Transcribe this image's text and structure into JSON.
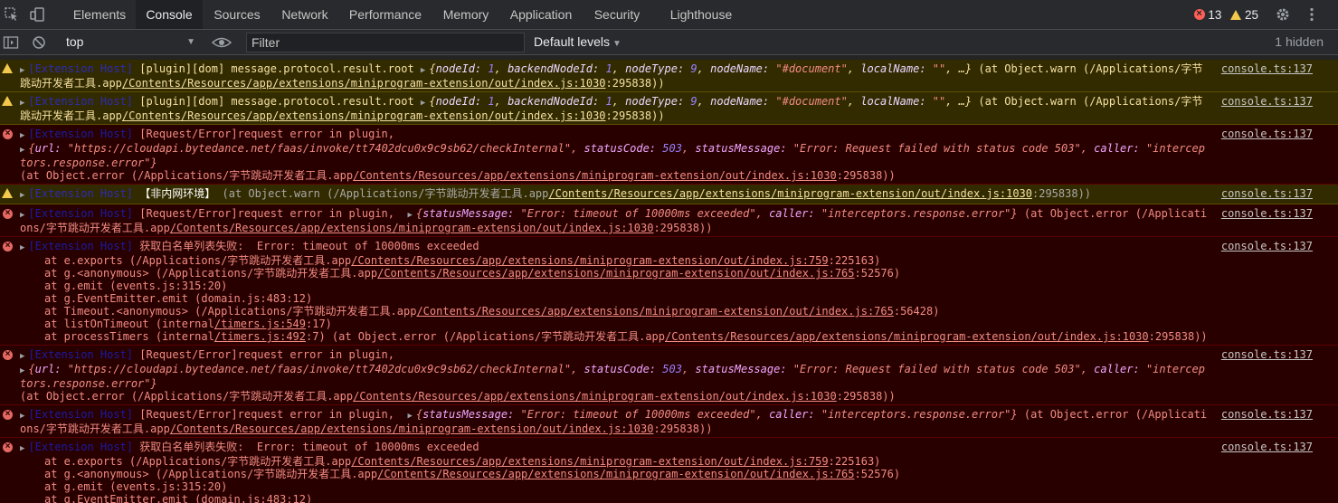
{
  "tabs": [
    "Elements",
    "Console",
    "Sources",
    "Network",
    "Performance",
    "Memory",
    "Application",
    "Security",
    "Lighthouse"
  ],
  "errors_count": "13",
  "warnings_count": "25",
  "context": "top",
  "filter_placeholder": "Filter",
  "levels": "Default levels",
  "hidden": "1 hidden",
  "colors": {
    "error": "#f28b82",
    "warning": "#f2c94c"
  },
  "src": "console.ts:137",
  "ext": "[Extension Host]",
  "paths": {
    "app_prefix": "(/Applications/字节跳动开发者工具.app",
    "wrapped_head": "(/Applications/字节",
    "wrapped_tail": "跳动开发者工具.app",
    "contents": "/Contents/Resources/app/extensions/miniprogram-extension/out/index.js:1030",
    "contents_759": "/Contents/Resources/app/extensions/miniprogram-extension/out/index.js:759",
    "contents_765": "/Contents/Resources/app/extensions/miniprogram-extension/out/index.js:765",
    "pos_main": ":295838))",
    "pos_main_1": ":295838)",
    "pos_759": ":225163)",
    "pos_765a": ":52576)",
    "pos_765b": ":56428)"
  },
  "w1": {
    "text": "[plugin][dom] message.protocol.result.root",
    "obj_open": "{",
    "k1": "nodeId:",
    "v1": "1",
    "k2": "backendNodeId:",
    "v2": "1",
    "k3": "nodeType:",
    "v3": "9",
    "k4": "nodeName:",
    "v4": "\"#document\"",
    "k5": "localName:",
    "v5": "\"\"",
    "obj_close": ", …}",
    "at": "(at Object.warn "
  },
  "e1": {
    "text": "[Request/Error]request error in plugin,",
    "k_url": "url:",
    "v_url": "\"https://cloudapi.bytedance.net/faas/invoke/tt7402dcu0x9c9sb62/checkInternal\"",
    "k_code": "statusCode:",
    "v_code": "503",
    "k_msg": "statusMessage:",
    "v_msg": "\"Error: Request failed with status code 503\"",
    "k_caller": "caller:",
    "v_caller": "\"interceptors.response.error\"",
    "at": "(at Object.error "
  },
  "w3": {
    "text": "【非内网环境】",
    "at": "(at Object.warn "
  },
  "e2": {
    "k_msg": "statusMessage:",
    "v_msg": "\"Error: timeout of 10000ms exceeded\"",
    "k_caller": "caller:",
    "v_caller": "\"interceptors.response.error\""
  },
  "e3": {
    "text": "获取白名单列表失败:  Error: timeout of 10000ms exceeded",
    "s1": "at e.exports ",
    "s2": "at g.<anonymous> ",
    "s3": "at g.emit (events.js:315:20)",
    "s4": "at g.EventEmitter.emit (domain.js:483:12)",
    "s5": "at Timeout.<anonymous> ",
    "s6_a": "at listOnTimeout (internal",
    "s6_b": "/timers.js:549",
    "s6_c": ":17)",
    "s7_a": "at processTimers (internal",
    "s7_b": "/timers.js:492",
    "s7_c": ":7) (at Object.error "
  }
}
